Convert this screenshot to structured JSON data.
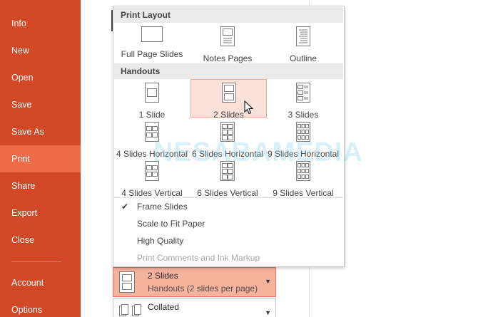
{
  "sidebar": {
    "items": [
      {
        "label": "Info"
      },
      {
        "label": "New"
      },
      {
        "label": "Open"
      },
      {
        "label": "Save"
      },
      {
        "label": "Save As"
      },
      {
        "label": "Print",
        "active": true
      },
      {
        "label": "Share"
      },
      {
        "label": "Export"
      },
      {
        "label": "Close"
      },
      {
        "label": "Account"
      },
      {
        "label": "Options"
      }
    ],
    "colors": {
      "background": "#d24726",
      "active": "#ed6c47"
    }
  },
  "dropdown": {
    "print_layout_header": "Print Layout",
    "print_layout": [
      {
        "label": "Full Page Slides",
        "icon": "full-page-slide-icon"
      },
      {
        "label": "Notes Pages",
        "icon": "notes-page-icon"
      },
      {
        "label": "Outline",
        "icon": "outline-icon"
      }
    ],
    "handouts_header": "Handouts",
    "handouts": [
      {
        "label": "1 Slide",
        "icon": "handout-1-slide-icon"
      },
      {
        "label": "2 Slides",
        "icon": "handout-2-slides-icon",
        "selected": true
      },
      {
        "label": "3 Slides",
        "icon": "handout-3-slides-icon"
      },
      {
        "label": "4 Slides Horizontal",
        "icon": "handout-4h-icon"
      },
      {
        "label": "6 Slides Horizontal",
        "icon": "handout-6h-icon"
      },
      {
        "label": "9 Slides Horizontal",
        "icon": "handout-9h-icon"
      },
      {
        "label": "4 Slides Vertical",
        "icon": "handout-4v-icon"
      },
      {
        "label": "6 Slides Vertical",
        "icon": "handout-6v-icon"
      },
      {
        "label": "9 Slides Vertical",
        "icon": "handout-9v-icon"
      }
    ],
    "options": [
      {
        "label": "Frame Slides",
        "checked": true
      },
      {
        "label": "Scale to Fit Paper",
        "checked": false
      },
      {
        "label": "High Quality",
        "checked": false
      },
      {
        "label": "Print Comments and Ink Markup",
        "checked": false,
        "disabled": true
      }
    ]
  },
  "watermark": {
    "text": "NESABAMEDIA"
  },
  "settings": {
    "layout": {
      "title": "2 Slides",
      "subtitle": "Handouts (2 slides per page)",
      "icon": "handout-2-slides-icon"
    },
    "collation": {
      "title": "Collated",
      "icon": "collated-pages-icon"
    }
  }
}
